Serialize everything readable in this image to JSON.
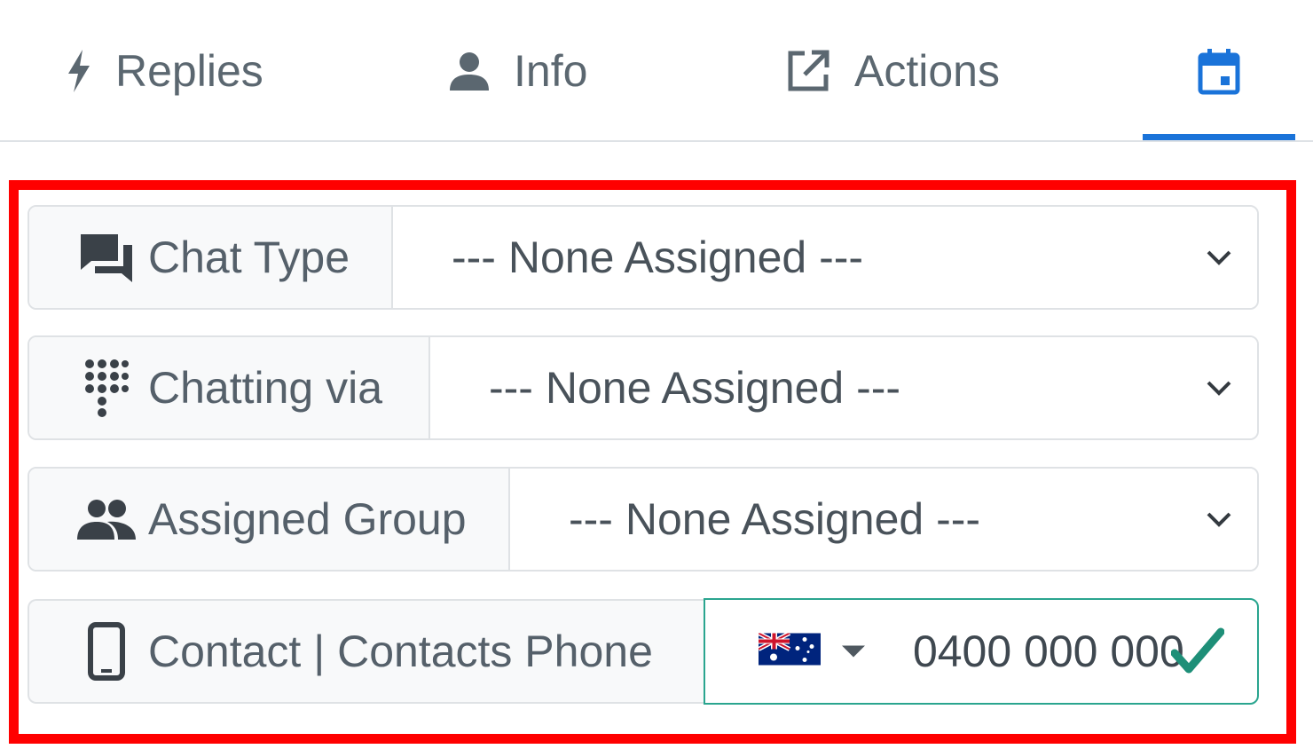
{
  "tabs": {
    "replies": {
      "label": "Replies",
      "icon": "lightning-bolt-icon"
    },
    "info": {
      "label": "Info",
      "icon": "person-icon"
    },
    "actions": {
      "label": "Actions",
      "icon": "external-link-icon"
    },
    "calendar": {
      "label": "",
      "icon": "calendar-icon",
      "active": true
    }
  },
  "fields": {
    "chat_type": {
      "label": "Chat Type",
      "icon": "chat-bubbles-icon",
      "selected": "--- None Assigned ---"
    },
    "chatting_via": {
      "label": "Chatting via",
      "icon": "dialpad-icon",
      "selected": "--- None Assigned ---"
    },
    "assigned_group": {
      "label": "Assigned Group",
      "icon": "group-icon",
      "selected": "--- None Assigned ---"
    },
    "contact_phone": {
      "label": "Contact | Contacts Phone",
      "icon": "mobile-phone-icon",
      "country_flag": "australia-flag-icon",
      "value": "0400 000 000",
      "valid": true
    }
  },
  "colors": {
    "accent": "#1a73d9",
    "highlight": "#ff0000",
    "valid": "#2aa58f",
    "text": "#5b6770"
  }
}
